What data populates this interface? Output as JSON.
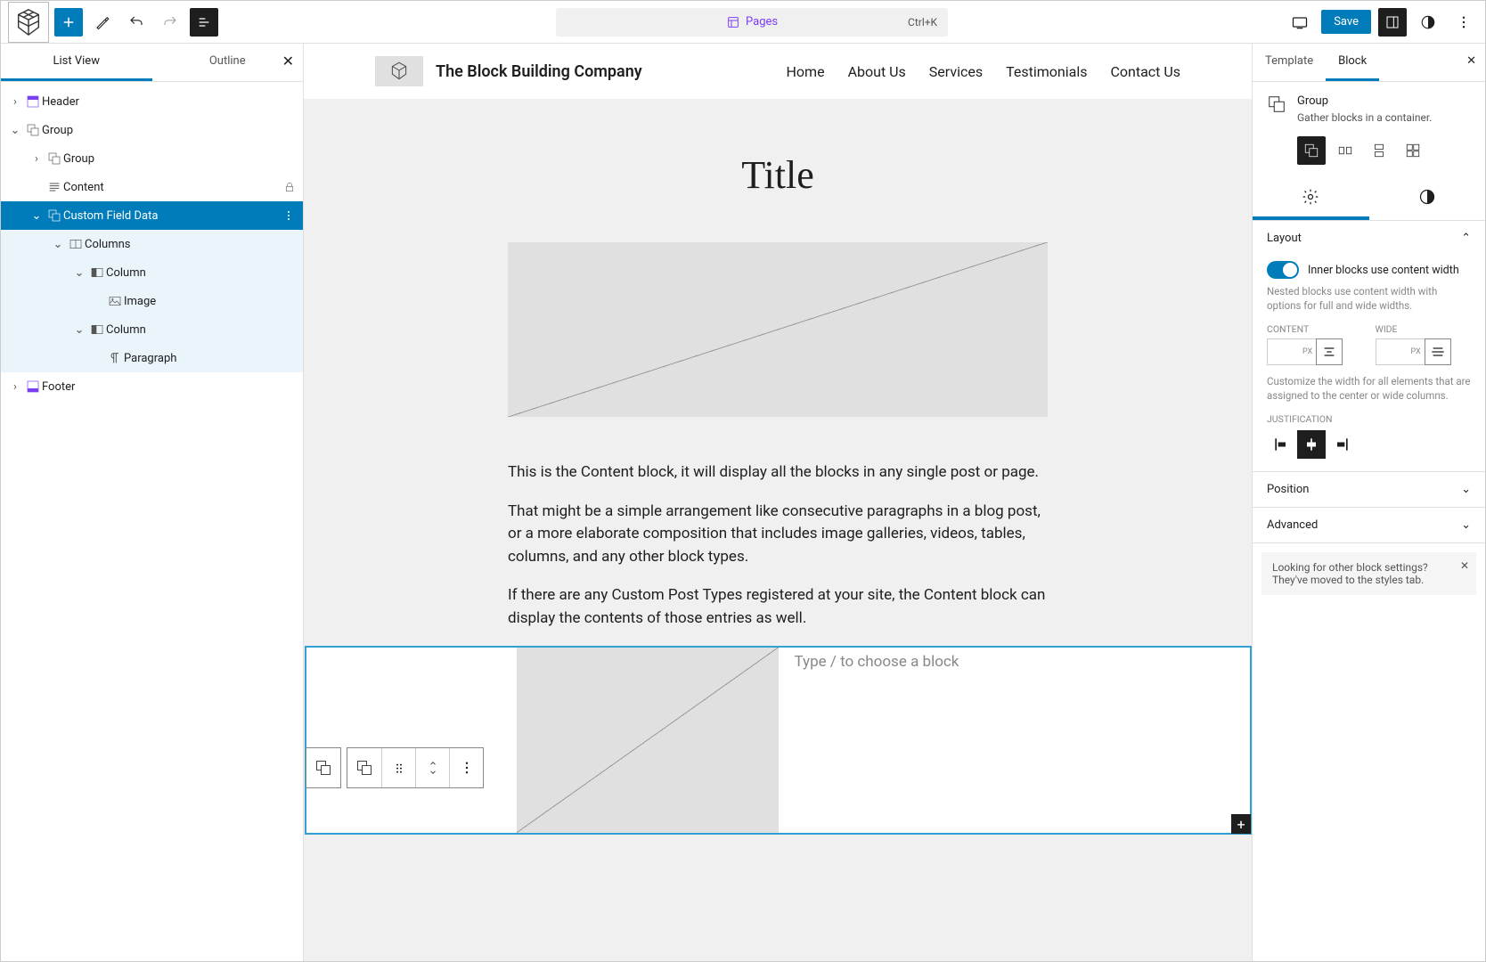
{
  "topbar": {
    "center": {
      "label": "Pages",
      "shortcut": "Ctrl+K"
    },
    "save": "Save"
  },
  "left": {
    "tabs": {
      "list": "List View",
      "outline": "Outline"
    },
    "tree": {
      "header": "Header",
      "group": "Group",
      "group2": "Group",
      "content": "Content",
      "cfd": "Custom Field Data",
      "columns": "Columns",
      "column1": "Column",
      "image": "Image",
      "column2": "Column",
      "paragraph": "Paragraph",
      "footer": "Footer"
    }
  },
  "canvas": {
    "sitetitle": "The Block Building Company",
    "nav": [
      "Home",
      "About Us",
      "Services",
      "Testimonials",
      "Contact Us"
    ],
    "pagetitle": "Title",
    "p1": "This is the Content block, it will display all the blocks in any single post or page.",
    "p2": "That might be a simple arrangement like consecutive paragraphs in a blog post, or a more elaborate composition that includes image galleries, videos, tables, columns, and any other block types.",
    "p3": "If there are any Custom Post Types registered at your site, the Content block can display the contents of those entries as well.",
    "placeholder": "Type / to choose a block"
  },
  "right": {
    "tabs": {
      "template": "Template",
      "block": "Block"
    },
    "block": {
      "name": "Group",
      "desc": "Gather blocks in a container."
    },
    "layout": {
      "title": "Layout",
      "toggleLabel": "Inner blocks use content width",
      "help": "Nested blocks use content width with options for full and wide widths.",
      "contentLabel": "CONTENT",
      "wideLabel": "WIDE",
      "unit": "PX",
      "help2": "Customize the width for all elements that are assigned to the center or wide columns.",
      "justLabel": "JUSTIFICATION"
    },
    "position": "Position",
    "advanced": "Advanced",
    "tip": "Looking for other block settings? They've moved to the styles tab."
  }
}
